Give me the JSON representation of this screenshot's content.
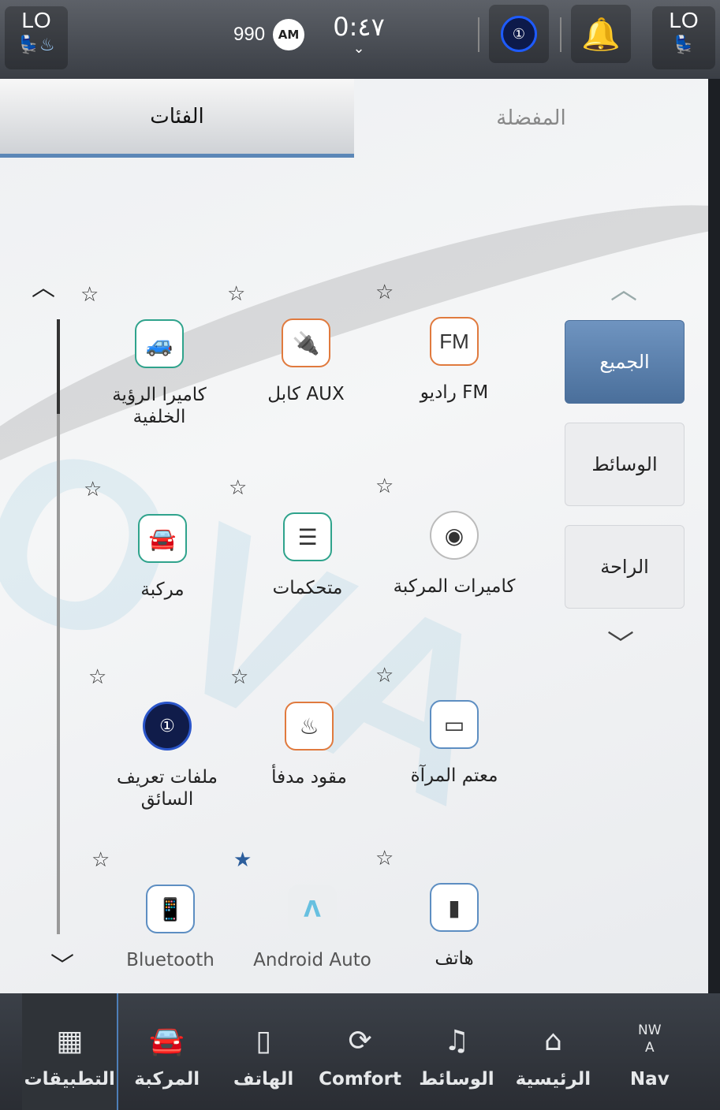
{
  "status": {
    "left_temp": "LO",
    "right_temp": "LO",
    "left_icons": "💺♨",
    "right_icon": "💺",
    "radio_freq": "990",
    "radio_band": "AM",
    "time": "0:٤٧",
    "time_chevron": "⌄",
    "profile_icon": "①",
    "bell_icon": "🔔"
  },
  "tabs": [
    {
      "label": "الفئات",
      "active": true
    },
    {
      "label": "المفضلة",
      "active": false
    }
  ],
  "categories": {
    "up": "︿",
    "down": "﹀",
    "items": [
      {
        "label": "الجميع",
        "active": true
      },
      {
        "label": "الوسائط",
        "active": false
      },
      {
        "label": "الراحة",
        "active": false
      }
    ]
  },
  "scroll": {
    "up": "︿",
    "down": "﹀"
  },
  "apps": [
    {
      "label": "راديو FM",
      "glyph": "FM",
      "star": "☆"
    },
    {
      "label": "كابل AUX",
      "glyph": "🔌",
      "star": "☆"
    },
    {
      "label": "كاميرا الرؤية الخلفية",
      "glyph": "🚙",
      "star": "☆"
    },
    {
      "label": "كاميرات المركبة",
      "glyph": "◉",
      "star": "☆"
    },
    {
      "label": "متحكمات",
      "glyph": "☰",
      "star": "☆"
    },
    {
      "label": "مركبة",
      "glyph": "🚘",
      "star": "☆"
    },
    {
      "label": "معتم المرآة",
      "glyph": "▭",
      "star": "☆"
    },
    {
      "label": "مقود مدفأ",
      "glyph": "♨",
      "star": "☆"
    },
    {
      "label": "ملفات تعريف السائق",
      "glyph": "①",
      "star": "☆"
    },
    {
      "label": "هاتف",
      "glyph": "▮",
      "star": "☆"
    },
    {
      "label": "Android Auto",
      "glyph": "Λ",
      "star": "★"
    },
    {
      "label": "Bluetooth",
      "glyph": "📱",
      "star": "☆"
    }
  ],
  "nav": {
    "compass_dir": "NW",
    "compass_arrow": "A",
    "items": [
      {
        "label": "Nav",
        "icon": ""
      },
      {
        "label": "الرئيسية",
        "icon": "⌂"
      },
      {
        "label": "الوسائط",
        "icon": "♫"
      },
      {
        "label": "Comfort",
        "icon": "⟳"
      },
      {
        "label": "الهاتف",
        "icon": "▯"
      },
      {
        "label": "المركبة",
        "icon": "🚘"
      },
      {
        "label": "التطبيقات",
        "icon": "▦"
      }
    ]
  }
}
